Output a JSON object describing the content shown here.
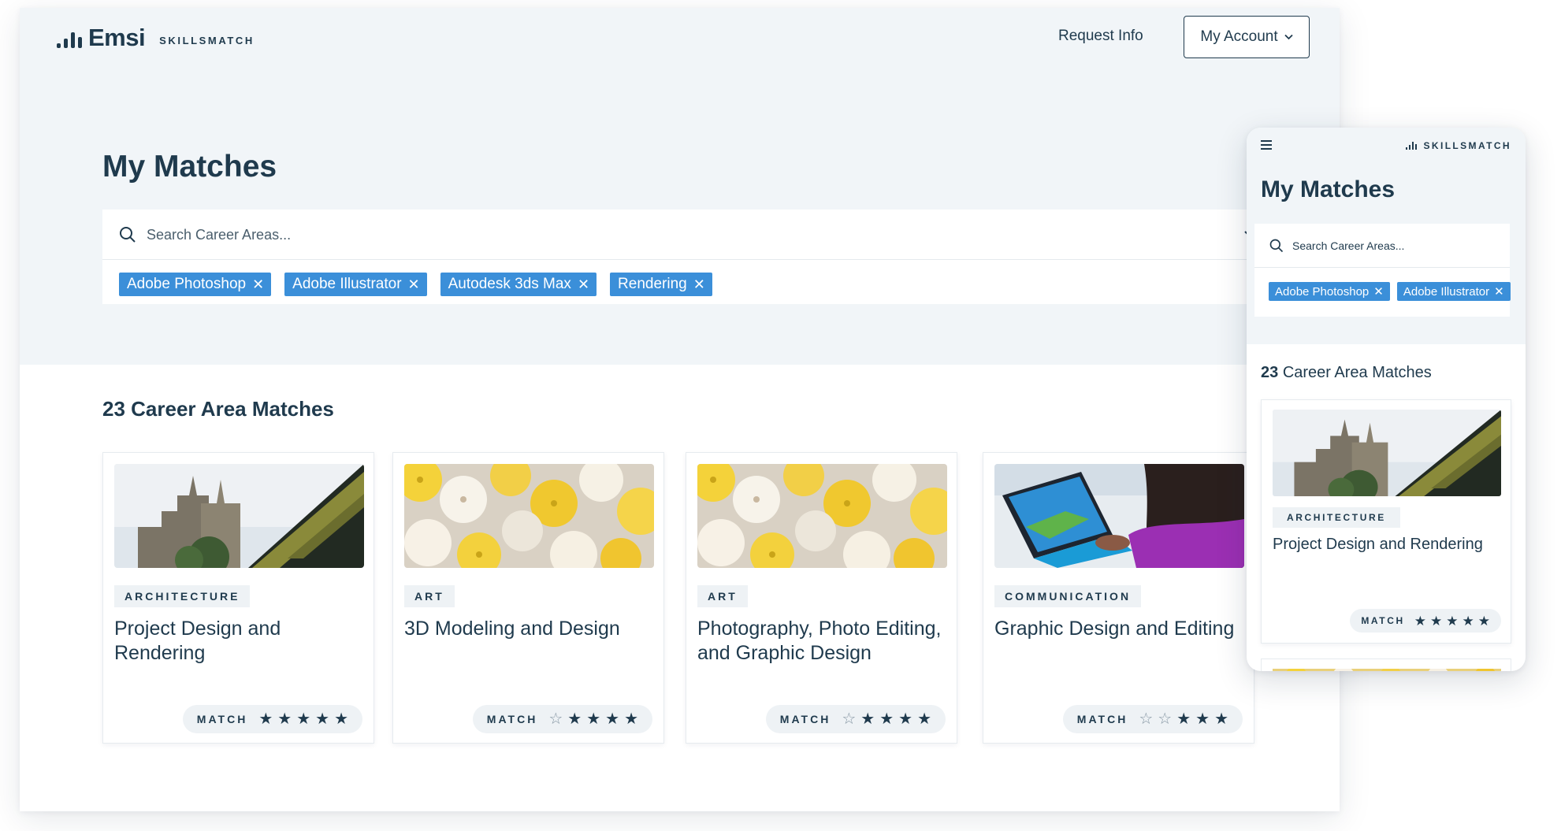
{
  "brand": {
    "name": "Emsi",
    "product": "SKILLSMATCH"
  },
  "nav": {
    "request_info": "Request Info",
    "account_label": "My Account"
  },
  "page": {
    "title": "My Matches"
  },
  "search": {
    "placeholder": "Search Career Areas..."
  },
  "tags": [
    "Adobe Photoshop",
    "Adobe Illustrator",
    "Autodesk 3ds Max",
    "Rendering"
  ],
  "results": {
    "count": "23",
    "label": "Career Area Matches",
    "full": "23 Career Area Matches"
  },
  "match_label": "MATCH",
  "cards": [
    {
      "category": "ARCHITECTURE",
      "title": "Project Design and Rendering",
      "image": "castle-rooftop-photo",
      "stars_filled": 5,
      "stars_total": 5
    },
    {
      "category": "ART",
      "title": "3D Modeling and Design",
      "image": "paper-fans-photo",
      "stars_filled": 4,
      "stars_total": 5
    },
    {
      "category": "ART",
      "title": "Photography, Photo Editing, and Graphic Design",
      "image": "paper-fans-photo",
      "stars_filled": 4,
      "stars_total": 5
    },
    {
      "category": "COMMUNICATION",
      "title": "Graphic Design and Editing",
      "image": "laptop-tablet-photo",
      "stars_filled": 3,
      "stars_total": 5
    }
  ],
  "mobile": {
    "brand": "SKILLSMATCH",
    "title": "My Matches",
    "search_placeholder": "Search Career Areas...",
    "tags": [
      "Adobe Photoshop",
      "Adobe Illustrator"
    ],
    "results_count": "23",
    "results_label": "Career Area Matches",
    "card": {
      "category": "ARCHITECTURE",
      "title": "Project Design and Rendering",
      "stars_filled": 5,
      "stars_total": 5
    }
  },
  "colors": {
    "primary": "#1f3a4d",
    "tag": "#3b8fd9",
    "hero_bg": "#f1f5f8",
    "pill_bg": "#eef2f5"
  },
  "icons": [
    "search-icon",
    "chevron-down-icon",
    "close-icon",
    "star-icon",
    "star-outline-icon",
    "hamburger-menu-icon",
    "logo-bars-icon"
  ]
}
